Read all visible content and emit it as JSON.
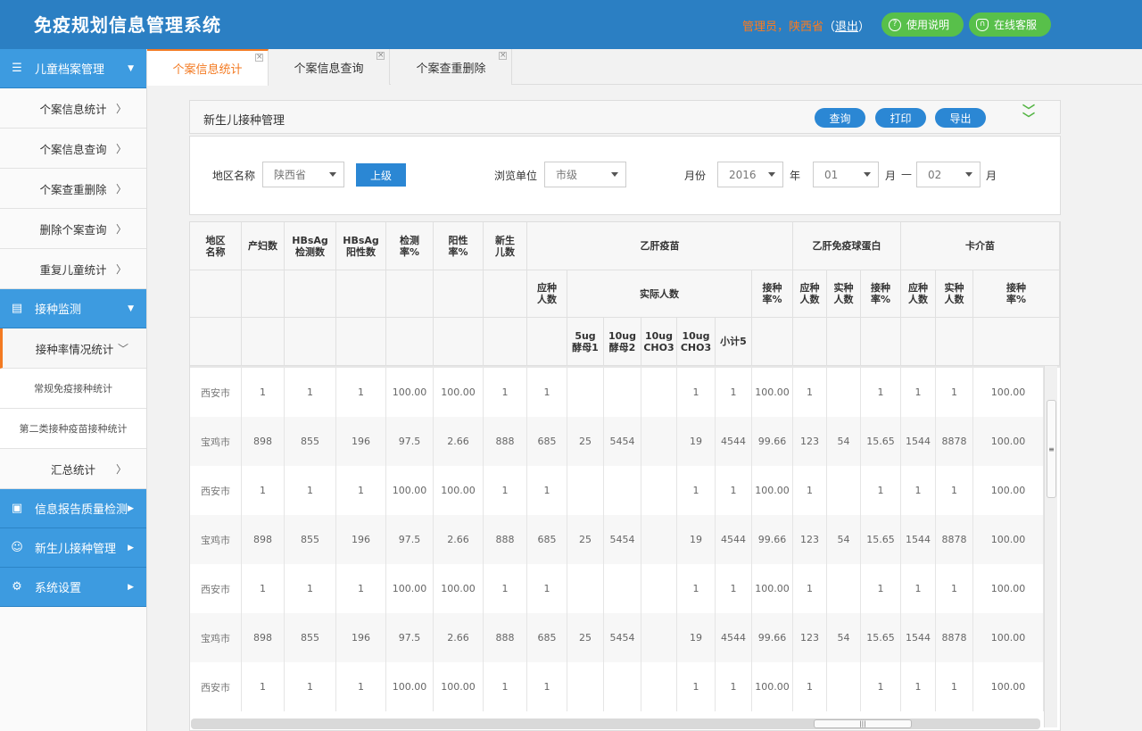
{
  "app": {
    "title": "免疫规划信息管理系统"
  },
  "header": {
    "user_label": "管理员，陕西省",
    "paren_open": "（",
    "logout": "退出",
    "paren_close": "）",
    "help_button": "使用说明",
    "service_button": "在线客服"
  },
  "sidebar": {
    "groups": [
      {
        "label": "儿童档案管理",
        "icon": "list-icon"
      },
      {
        "label": "接种监测",
        "icon": "monitor-chart-icon"
      },
      {
        "label": "信息报告质量检测",
        "icon": "clipboard-icon"
      },
      {
        "label": "新生儿接种管理",
        "icon": "baby-face-icon"
      },
      {
        "label": "系统设置",
        "icon": "gear-icon"
      }
    ],
    "archive_items": [
      "个案信息统计",
      "个案信息查询",
      "个案查重删除",
      "删除个案查询",
      "重复儿童统计"
    ],
    "monitor_items": {
      "rate_stats": "接种率情况统计",
      "sub1": "常规免疫接种统计",
      "sub2": "第二类接种疫苗接种统计",
      "summary": "汇总统计"
    }
  },
  "tabs": [
    {
      "label": "个案信息统计",
      "active": true
    },
    {
      "label": "个案信息查询",
      "active": false
    },
    {
      "label": "个案查重删除",
      "active": false
    }
  ],
  "panel": {
    "title": "新生儿接种管理",
    "query_btn": "查询",
    "print_btn": "打印",
    "export_btn": "导出"
  },
  "filters": {
    "region_label": "地区名称",
    "region_value": "陕西省",
    "up_button": "上级",
    "unit_label": "浏览单位",
    "unit_value": "市级",
    "month_label": "月份",
    "year_value": "2016",
    "year_suffix": "年",
    "month_from": "01",
    "month_mid": "月",
    "dash": "—",
    "month_to": "02",
    "month_suffix": "月"
  },
  "table": {
    "headers": {
      "region": "地区\n名称",
      "births": "产妇数",
      "hbsag_test": "HBsAg\n检测数",
      "hbsag_pos": "HBsAg\n阳性数",
      "test_rate": "检测\n率%",
      "pos_rate": "阳性\n率%",
      "newborn": "新生\n儿数",
      "hepb": "乙肝疫苗",
      "hbig": "乙肝免疫球蛋白",
      "bcg": "卡介苗",
      "should": "应种\n人数",
      "actual": "实际人数",
      "rate": "接种\n率%",
      "actual_short": "实种\n人数",
      "v5ug": "5ug\n酵母1",
      "v10ug_y": "10ug\n酵母2",
      "v10ug_c1": "10ug\nCHO3",
      "v10ug_c2": "10ug\nCHO3",
      "subtotal": "小计5"
    },
    "rows": [
      [
        "西安市",
        "1",
        "1",
        "1",
        "100.00",
        "100.00",
        "1",
        "1",
        "",
        "",
        "",
        "1",
        "1",
        "100.00",
        "1",
        "",
        "1",
        "1",
        "1",
        "100.00"
      ],
      [
        "宝鸡市",
        "898",
        "855",
        "196",
        "97.5",
        "2.66",
        "888",
        "685",
        "25",
        "5454",
        "",
        "19",
        "4544",
        "99.66",
        "123",
        "54",
        "15.65",
        "1544",
        "8878",
        "100.00"
      ],
      [
        "西安市",
        "1",
        "1",
        "1",
        "100.00",
        "100.00",
        "1",
        "1",
        "",
        "",
        "",
        "1",
        "1",
        "100.00",
        "1",
        "",
        "1",
        "1",
        "1",
        "100.00"
      ],
      [
        "宝鸡市",
        "898",
        "855",
        "196",
        "97.5",
        "2.66",
        "888",
        "685",
        "25",
        "5454",
        "",
        "19",
        "4544",
        "99.66",
        "123",
        "54",
        "15.65",
        "1544",
        "8878",
        "100.00"
      ],
      [
        "西安市",
        "1",
        "1",
        "1",
        "100.00",
        "100.00",
        "1",
        "1",
        "",
        "",
        "",
        "1",
        "1",
        "100.00",
        "1",
        "",
        "1",
        "1",
        "1",
        "100.00"
      ],
      [
        "宝鸡市",
        "898",
        "855",
        "196",
        "97.5",
        "2.66",
        "888",
        "685",
        "25",
        "5454",
        "",
        "19",
        "4544",
        "99.66",
        "123",
        "54",
        "15.65",
        "1544",
        "8878",
        "100.00"
      ],
      [
        "西安市",
        "1",
        "1",
        "1",
        "100.00",
        "100.00",
        "1",
        "1",
        "",
        "",
        "",
        "1",
        "1",
        "100.00",
        "1",
        "",
        "1",
        "1",
        "1",
        "100.00"
      ]
    ]
  },
  "colors": {
    "header_blue": "#2b7fc3",
    "accent_orange": "#f37a22",
    "green": "#58c04a",
    "sidebar_blue": "#3d9be0"
  }
}
